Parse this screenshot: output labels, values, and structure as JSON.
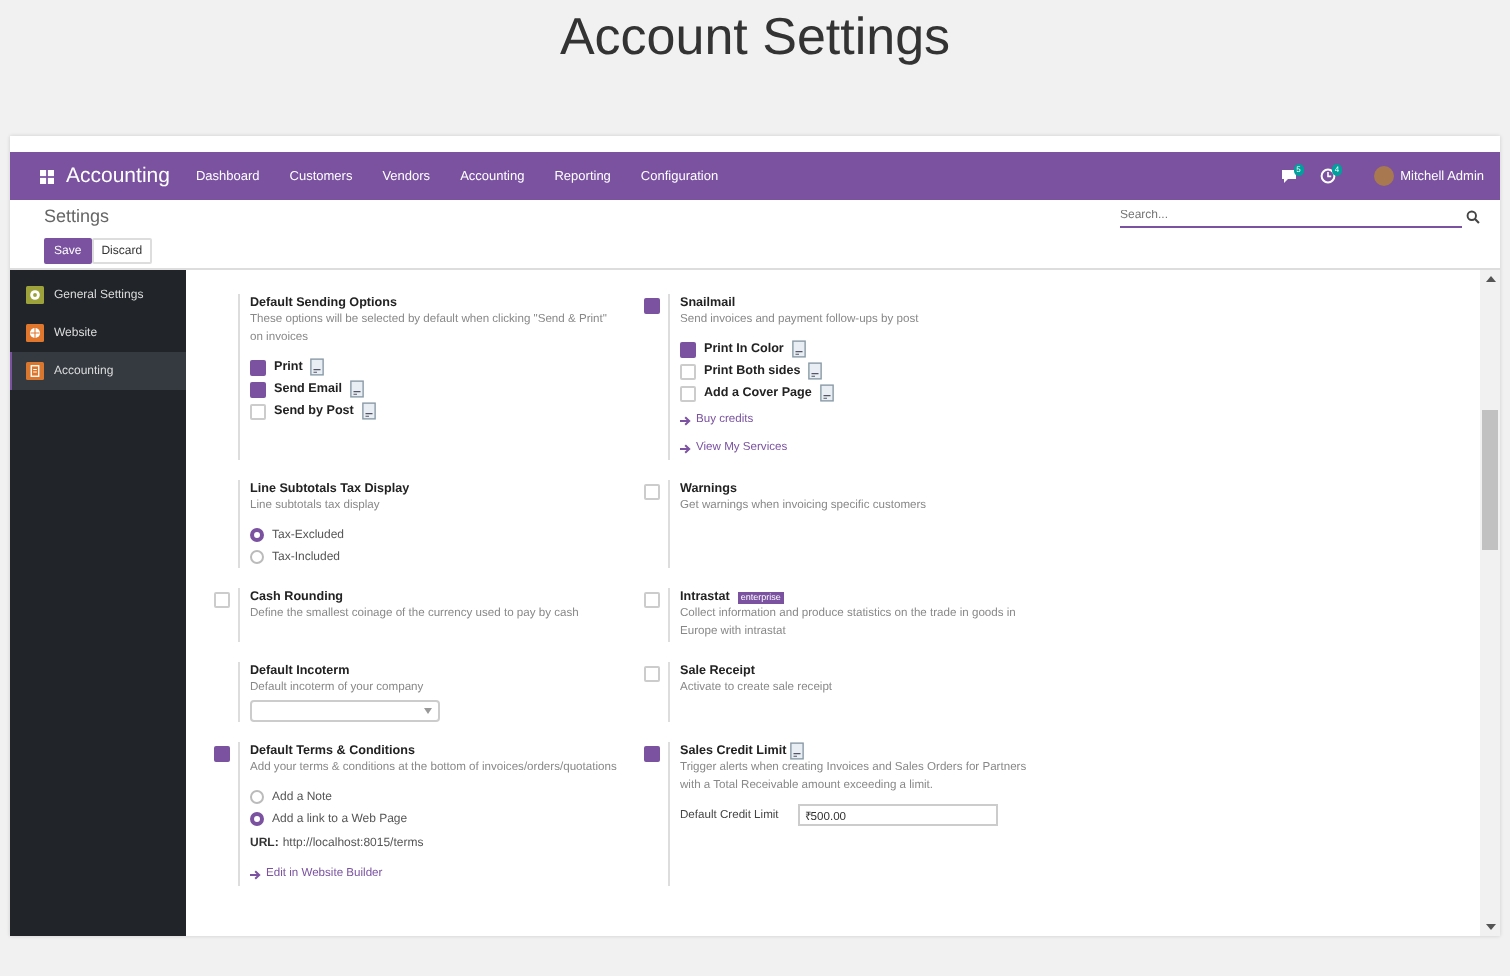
{
  "page_title": "Account Settings",
  "navbar": {
    "app_name": "Accounting",
    "menu": [
      "Dashboard",
      "Customers",
      "Vendors",
      "Accounting",
      "Reporting",
      "Configuration"
    ],
    "messages_badge": "5",
    "activity_badge": "4",
    "user": "Mitchell Admin"
  },
  "control_panel": {
    "breadcrumb": "Settings",
    "search": {
      "placeholder": "Search..."
    },
    "buttons": [
      {
        "label": "Save",
        "kind": "primary"
      },
      {
        "label": "Discard",
        "kind": "secondary"
      }
    ]
  },
  "sidebar": {
    "items": [
      {
        "label": "General Settings",
        "color": "#9ea23a",
        "selected": false
      },
      {
        "label": "Website",
        "color": "#e0772c",
        "selected": false
      },
      {
        "label": "Accounting",
        "color": "#d9772f",
        "selected": true
      }
    ]
  },
  "rows": [
    [
      {
        "title": "Default Sending Options",
        "description": "These options will be selected by default when clicking \"Send & Print\" on invoices",
        "options": [
          {
            "kind": "checkbox",
            "label": "Print",
            "checked": true,
            "has_doc_icon": true
          },
          {
            "kind": "checkbox",
            "label": "Send Email",
            "checked": true,
            "has_doc_icon": true
          },
          {
            "kind": "checkbox",
            "label": "Send by Post",
            "checked": false,
            "has_doc_icon": true
          }
        ]
      },
      {
        "title": "Snailmail",
        "checked": true,
        "description": "Send invoices and payment follow-ups by post",
        "options": [
          {
            "kind": "checkbox",
            "label": "Print In Color",
            "checked": true,
            "has_doc_icon": true
          },
          {
            "kind": "checkbox",
            "label": "Print Both sides",
            "checked": false,
            "has_doc_icon": true
          },
          {
            "kind": "checkbox",
            "label": "Add a Cover Page",
            "checked": false,
            "has_doc_icon": true
          },
          {
            "kind": "link",
            "label": "Buy credits"
          },
          {
            "kind": "link",
            "label": "View My Services"
          }
        ]
      }
    ],
    [
      {
        "title": "Line Subtotals Tax Display",
        "description": "Line subtotals tax display",
        "options": [
          {
            "kind": "radio",
            "label": "Tax-Excluded",
            "selected": true
          },
          {
            "kind": "radio",
            "label": "Tax-Included",
            "selected": false
          }
        ]
      },
      {
        "title": "Warnings",
        "checked": false,
        "description": "Get warnings when invoicing specific customers"
      }
    ],
    [
      {
        "title": "Cash Rounding",
        "checked": false,
        "description": "Define the smallest coinage of the currency used to pay by cash"
      },
      {
        "title": "Intrastat",
        "checked": false,
        "badge": "enterprise",
        "description": "Collect information and produce statistics on the trade in goods in Europe with intrastat"
      }
    ],
    [
      {
        "title": "Default Incoterm",
        "description": "Default incoterm of your company",
        "options": [
          {
            "kind": "select"
          }
        ]
      },
      {
        "title": "Sale Receipt",
        "checked": false,
        "description": "Activate to create sale receipt"
      }
    ],
    [
      {
        "title": "Default Terms & Conditions",
        "checked": true,
        "description": "Add your terms & conditions at the bottom of invoices/orders/quotations",
        "options": [
          {
            "kind": "radio",
            "label": "Add a Note",
            "selected": false
          },
          {
            "kind": "radio",
            "label": "Add a link to a Web Page",
            "selected": true
          },
          {
            "kind": "url",
            "label": "URL:",
            "value": "http://localhost:8015/terms"
          },
          {
            "kind": "link",
            "label": "Edit in Website Builder"
          }
        ]
      },
      {
        "title": "Sales Credit Limit",
        "checked": true,
        "has_doc_icon": true,
        "description": "Trigger alerts when creating Invoices and Sales Orders for Partners with a Total Receivable amount exceeding a limit.",
        "options": [
          {
            "kind": "field",
            "label": "Default Credit Limit",
            "value": "₹500.00"
          }
        ]
      }
    ]
  ]
}
